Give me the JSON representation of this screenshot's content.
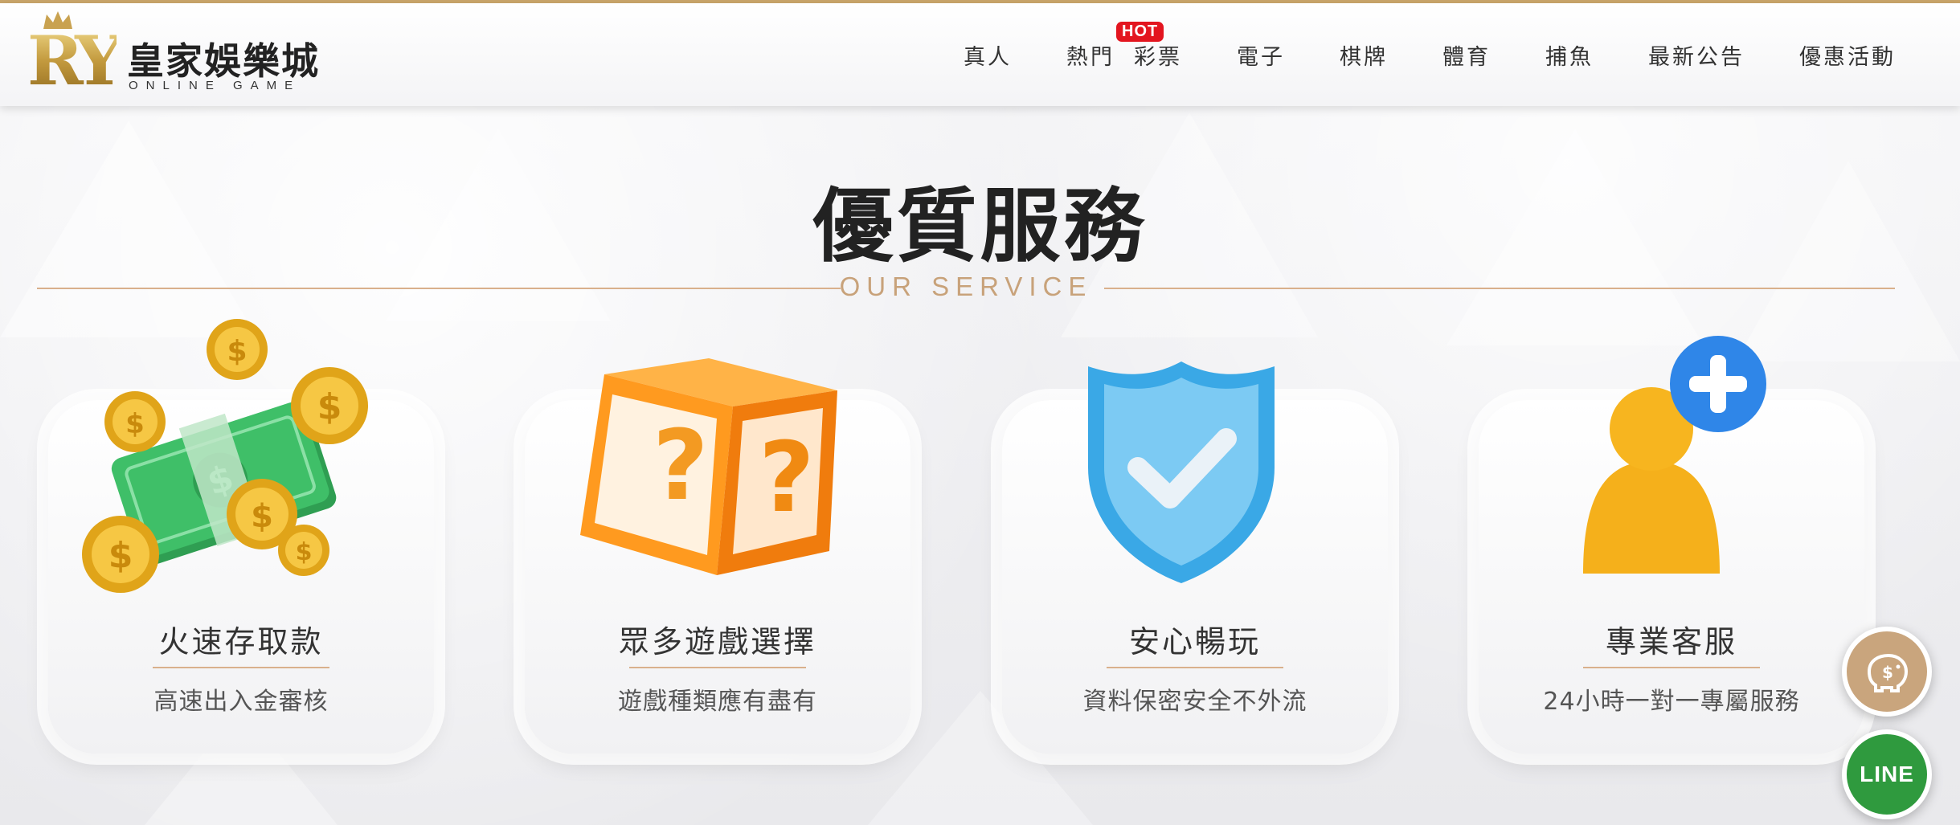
{
  "brand": {
    "logo_letters": "RY",
    "name": "皇家娛樂城",
    "tagline": "ONLINE GAME"
  },
  "nav": {
    "items": [
      {
        "label": "真人"
      },
      {
        "label": "熱門"
      },
      {
        "label": "彩票"
      },
      {
        "label": "電子"
      },
      {
        "label": "棋牌"
      },
      {
        "label": "體育"
      },
      {
        "label": "捕魚"
      },
      {
        "label": "最新公告"
      },
      {
        "label": "優惠活動"
      }
    ],
    "hot_badge": "HOT"
  },
  "section": {
    "title": "優質服務",
    "subtitle": "OUR SERVICE"
  },
  "cards": [
    {
      "title": "火速存取款",
      "desc": "高速出入金審核",
      "icon": "money-coins-icon"
    },
    {
      "title": "眾多遊戲選擇",
      "desc": "遊戲種類應有盡有",
      "icon": "mystery-box-icon"
    },
    {
      "title": "安心暢玩",
      "desc": "資料保密安全不外流",
      "icon": "shield-check-icon"
    },
    {
      "title": "專業客服",
      "desc": "24小時一對一專屬服務",
      "icon": "user-plus-icon"
    }
  ],
  "floating": {
    "deposit_icon": "piggy-bank-icon",
    "line_label": "LINE"
  },
  "colors": {
    "accent_gold": "#c9a56a",
    "hot_red": "#e3151f",
    "line_green": "#2f9a3e"
  }
}
